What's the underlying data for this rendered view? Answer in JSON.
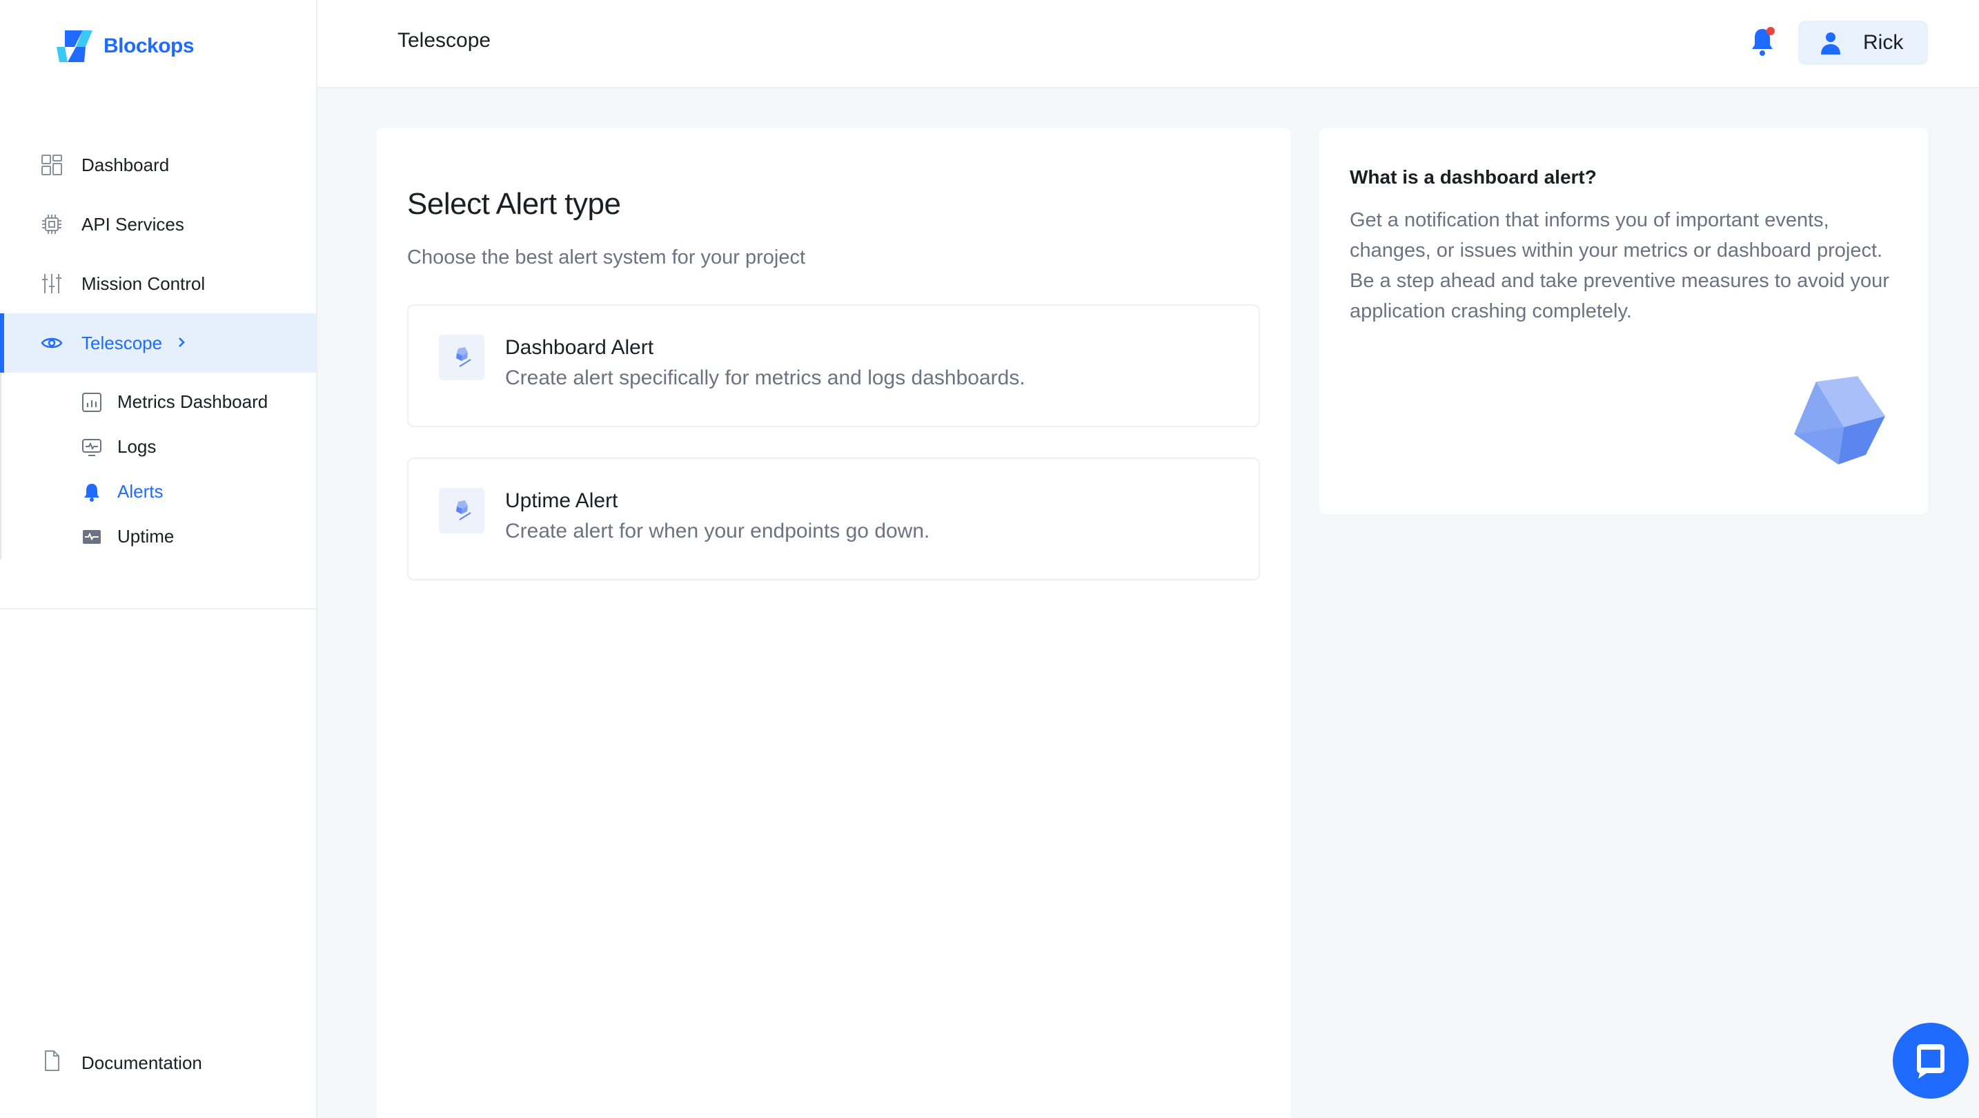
{
  "brand": {
    "name": "Blockops"
  },
  "sidebar": {
    "items": [
      {
        "label": "Dashboard",
        "icon": "dashboard-grid-icon"
      },
      {
        "label": "API Services",
        "icon": "chip-icon"
      },
      {
        "label": "Mission Control",
        "icon": "sliders-icon"
      },
      {
        "label": "Telescope",
        "icon": "eye-icon",
        "active": true
      }
    ],
    "subitems": [
      {
        "label": "Metrics Dashboard",
        "icon": "bar-chart-icon"
      },
      {
        "label": "Logs",
        "icon": "monitor-pulse-icon"
      },
      {
        "label": "Alerts",
        "icon": "bell-icon",
        "active": true
      },
      {
        "label": "Uptime",
        "icon": "uptime-icon"
      }
    ],
    "documentation": {
      "label": "Documentation",
      "icon": "document-icon"
    }
  },
  "header": {
    "title": "Telescope",
    "user": {
      "name": "Rick"
    }
  },
  "main": {
    "title": "Select Alert type",
    "subtitle": "Choose the best alert system for your project",
    "options": [
      {
        "title": "Dashboard Alert",
        "description": "Create alert specifically for metrics and logs dashboards."
      },
      {
        "title": "Uptime Alert",
        "description": "Create alert for when your endpoints go down."
      }
    ]
  },
  "info": {
    "title": "What is a dashboard alert?",
    "body": "Get a notification that informs you of important events, changes, or issues within your metrics or dashboard project. Be a step ahead and take preventive measures to avoid your application crashing completely."
  },
  "colors": {
    "accent": "#1f6bff",
    "active_bg": "#e6f0fd",
    "muted_text": "#6b7280",
    "notification_dot": "#e8473c"
  }
}
